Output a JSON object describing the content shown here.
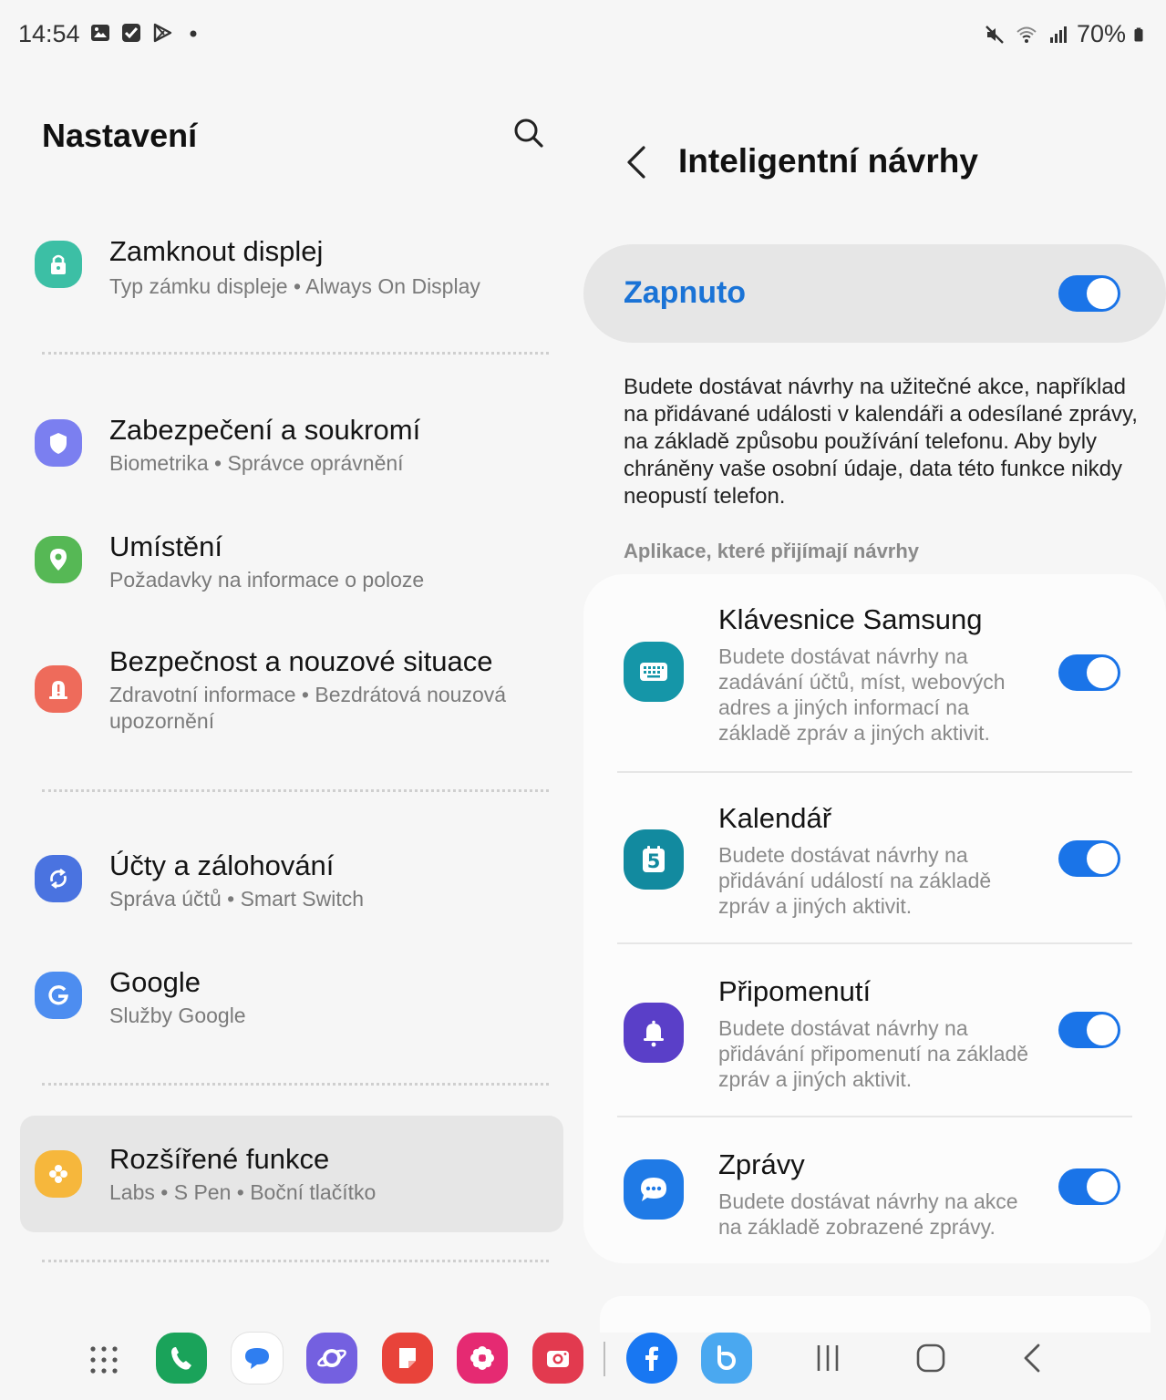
{
  "status_bar": {
    "time": "14:54",
    "battery": "70%",
    "left_icons": [
      "image-icon",
      "checkbox-icon",
      "play-store-icon",
      "dot-icon"
    ],
    "right_icons": [
      "mute-icon",
      "wifi-icon",
      "signal-icon",
      "battery-icon"
    ]
  },
  "left": {
    "title": "Nastavení",
    "items": [
      {
        "title": "Zamknout displej",
        "subtitle": "Typ zámku displeje  •  Always On Display",
        "icon": "lock-icon",
        "color": "#3cbfa5"
      },
      {
        "title": "Zabezpečení a soukromí",
        "subtitle": "Biometrika  •  Správce oprávnění",
        "icon": "shield-icon",
        "color": "#7b7ff0"
      },
      {
        "title": "Umístění",
        "subtitle": "Požadavky na informace o poloze",
        "icon": "location-pin-icon",
        "color": "#56b855"
      },
      {
        "title": "Bezpečnost a nouzové situace",
        "subtitle": "Zdravotní informace  •  Bezdrátová nouzová upozornění",
        "icon": "alert-icon",
        "color": "#ee6b5b"
      },
      {
        "title": "Účty a zálohování",
        "subtitle": "Správa účtů  •  Smart Switch",
        "icon": "sync-icon",
        "color": "#4a73e0"
      },
      {
        "title": "Google",
        "subtitle": "Služby Google",
        "icon": "google-icon",
        "color": "#4d8df0"
      },
      {
        "title": "Rozšířené funkce",
        "subtitle": "Labs  •  S Pen  •  Boční tlačítko",
        "icon": "puzzle-icon",
        "color": "#f6b73c"
      }
    ]
  },
  "right": {
    "title": "Inteligentní návrhy",
    "master_label": "Zapnuto",
    "master_on": true,
    "description": "Budete dostávat návrhy na užitečné akce, například na přidávané události v kalendáři a odesílané zprávy, na základě způsobu používání telefonu. Aby byly chráněny vaše osobní údaje, data této funkce nikdy neopustí telefon.",
    "section_label": "Aplikace, které přijímají návrhy",
    "apps": [
      {
        "title": "Klávesnice Samsung",
        "description": "Budete dostávat návrhy na zadávání účtů, míst, webových adres a jiných informací na základě zpráv a jiných aktivit.",
        "icon": "keyboard-icon",
        "color": "#1596a8",
        "on": true
      },
      {
        "title": "Kalendář",
        "description": "Budete dostávat návrhy na přidávání událostí na základě zpráv a jiných aktivit.",
        "icon": "calendar-icon",
        "color": "#128a9f",
        "on": true,
        "badge": "5"
      },
      {
        "title": "Připomenutí",
        "description": "Budete dostávat návrhy na přidávání připomenutí na základě zpráv a jiných aktivit.",
        "icon": "bell-icon",
        "color": "#5a3fc8",
        "on": true
      },
      {
        "title": "Zprávy",
        "description": "Budete dostávat návrhy na akce na základě zobrazené zprávy.",
        "icon": "chat-bubble-icon",
        "color": "#1f7ae6",
        "on": true
      }
    ]
  },
  "taskbar": {
    "apps": [
      {
        "name": "phone-icon",
        "color": "#1aa35a"
      },
      {
        "name": "messages-icon",
        "color": "#ffffff"
      },
      {
        "name": "internet-icon",
        "color": "#7460e0"
      },
      {
        "name": "notes-icon",
        "color": "#e8433a"
      },
      {
        "name": "gallery-icon",
        "color": "#e52a72"
      },
      {
        "name": "camera-icon",
        "color": "#e23a4f"
      },
      {
        "name": "facebook-icon",
        "color": "#1877f2"
      },
      {
        "name": "bixby-icon",
        "color": "#4aa8f0"
      }
    ],
    "nav": [
      "recents-icon",
      "home-icon",
      "back-icon"
    ]
  }
}
